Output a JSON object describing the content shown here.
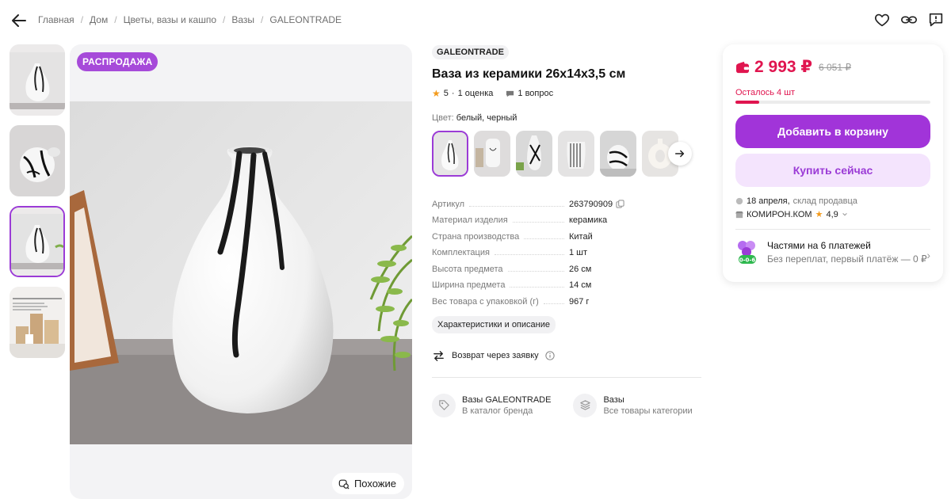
{
  "breadcrumbs": [
    "Главная",
    "Дом",
    "Цветы, вазы и кашпо",
    "Вазы",
    "GALEONTRADE"
  ],
  "icons": {
    "back": "arrow-left-icon",
    "favorite": "heart-icon",
    "share": "link-icon",
    "report": "feedback-icon"
  },
  "gallery": {
    "badge": "РАСПРОДАЖА",
    "similar_label": "Похожие",
    "thumb_count": 4,
    "active_thumb": 3
  },
  "product": {
    "brand": "GALEONTRADE",
    "title": "Ваза из керамики 26х14х3,5 см",
    "rating": "5",
    "rating_sep": "·",
    "reviews": "1 оценка",
    "questions": "1 вопрос",
    "color_label": "Цвет:",
    "color_value": "белый, черный"
  },
  "specs": [
    {
      "key": "Артикул",
      "value": "263790909"
    },
    {
      "key": "Материал изделия",
      "value": "керамика"
    },
    {
      "key": "Страна производства",
      "value": "Китай"
    },
    {
      "key": "Комплектация",
      "value": "1 шт"
    },
    {
      "key": "Высота предмета",
      "value": "26 см"
    },
    {
      "key": "Ширина предмета",
      "value": "14 см"
    },
    {
      "key": "Вес товара с упаковкой (г)",
      "value": "967 г"
    }
  ],
  "actions": {
    "characteristics": "Характеристики и описание",
    "return": "Возврат через заявку"
  },
  "links": [
    {
      "title": "Вазы GALEONTRADE",
      "subtitle": "В каталог бренда"
    },
    {
      "title": "Вазы",
      "subtitle": "Все товары категории"
    }
  ],
  "buy": {
    "price": "2 993 ₽",
    "old_price": "6 051 ₽",
    "left": "Осталось 4 шт",
    "stock_fraction": 0.12,
    "add_to_cart": "Добавить в корзину",
    "buy_now": "Купить сейчас",
    "delivery_date": "18 апреля,",
    "delivery_from": "склад продавца",
    "seller": "КОМИРОН.КОМ",
    "seller_rating": "4,9",
    "installments_title": "Частями на 6 платежей",
    "installments_sub": "Без переплат, первый платёж — 0 ₽",
    "installments_badge": "0-0-6"
  },
  "colors": {
    "accent": "#a134d9",
    "price": "#e0154f",
    "star": "#f39a1b"
  }
}
